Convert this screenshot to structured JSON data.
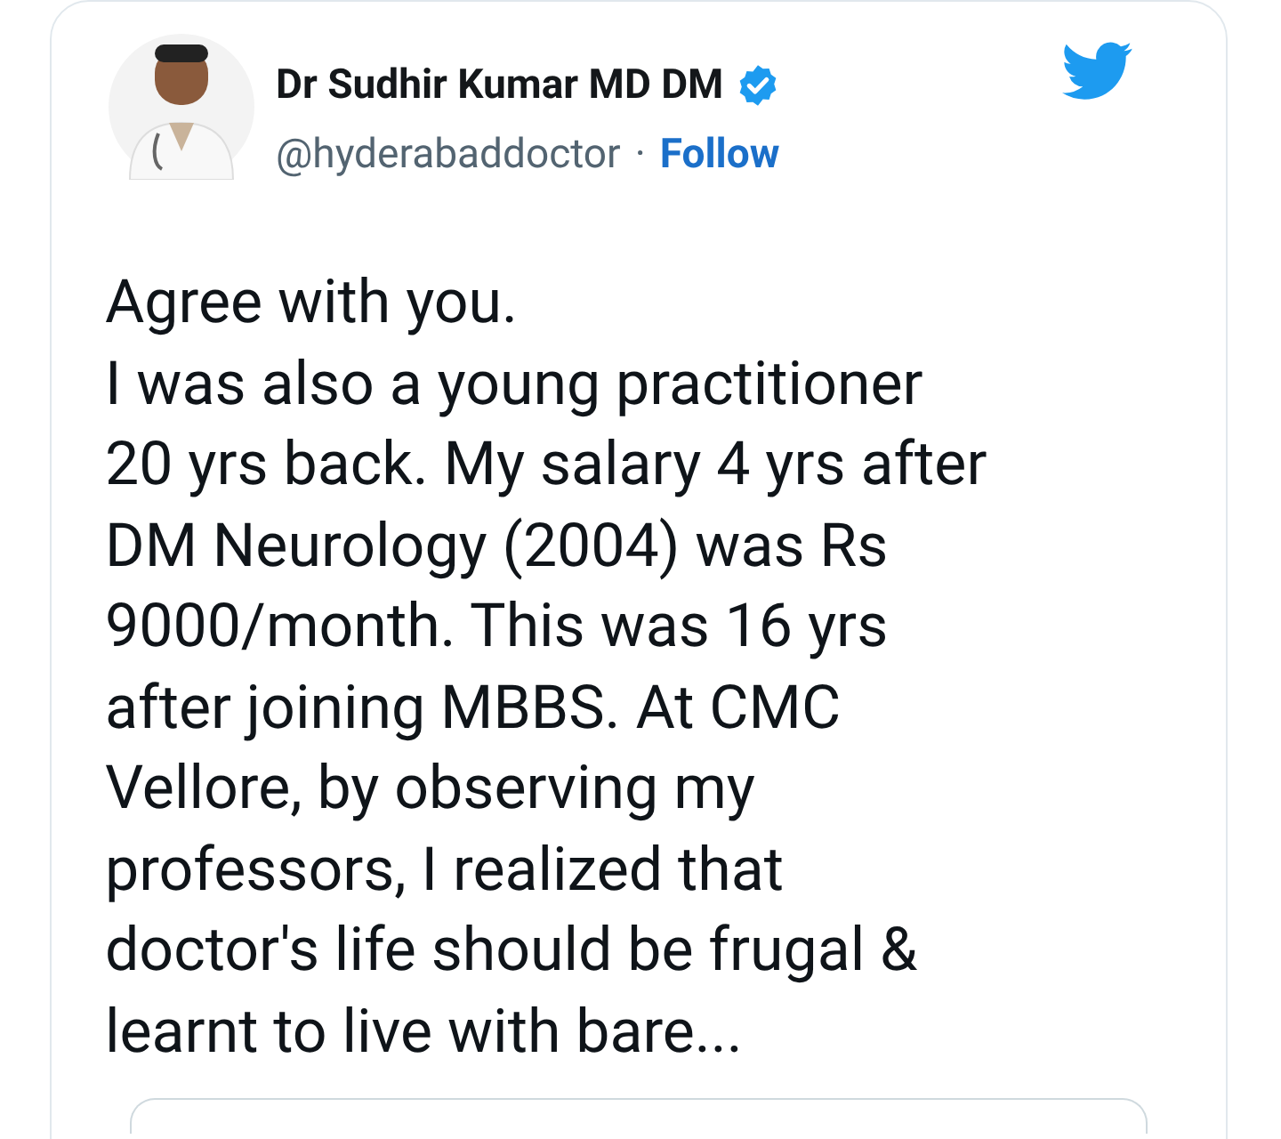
{
  "author": {
    "name": "Dr Sudhir Kumar MD DM",
    "verified": true,
    "handle": "@hyderabaddoctor",
    "separator": "·",
    "follow": "Follow"
  },
  "tweet": {
    "lines": [
      "Agree with you.",
      "I was also a young practitioner",
      "20 yrs back. My salary 4 yrs after",
      "DM Neurology (2004) was Rs",
      "9000/month. This was 16 yrs",
      "after joining MBBS. At CMC",
      "Vellore, by observing my",
      "professors, I realized that",
      "doctor's life should be frugal &",
      "learnt to live with bare..."
    ]
  }
}
